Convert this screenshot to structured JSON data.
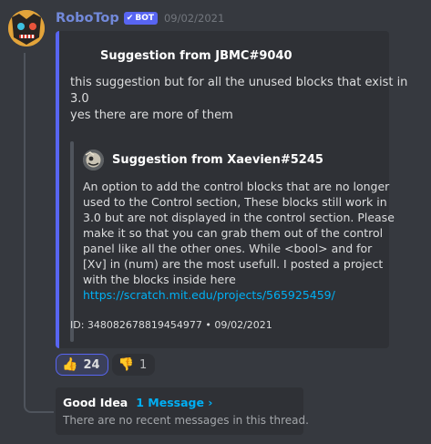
{
  "message": {
    "author": "RoboTop",
    "badge": "BOT",
    "badge_icon": "✔",
    "timestamp": "09/02/2021"
  },
  "embed": {
    "accent_color": "#5865f2",
    "author": "Suggestion from JBMC#9040",
    "description_lines": [
      "this suggestion but for all the unused blocks that exist in",
      "3.0",
      "yes there are more of them"
    ],
    "quote": {
      "author": "Suggestion from Xaevien#5245",
      "body_lines": [
        "An option to add the control blocks that are no longer",
        "used to the Control section, These blocks still work in",
        "3.0 but are not displayed in the control section. Please",
        "make it so that you can grab them out of the control",
        "panel like all the other ones. While <bool> and for",
        "[Xv] in (num) are the most usefull. I posted a project",
        "with the blocks inside here"
      ],
      "link": "https://scratch.mit.edu/projects/565925459/"
    },
    "footer": "ID: 348082678819454977 • 09/02/2021"
  },
  "reactions": [
    {
      "emoji": "👍",
      "emoji_name": "thumbs-up-icon",
      "count": "24",
      "active": true
    },
    {
      "emoji": "👎",
      "emoji_name": "thumbs-down-icon",
      "count": "1",
      "active": false
    }
  ],
  "thread": {
    "name": "Good Idea",
    "count_label": "1 Message ›",
    "subtitle": "There are no recent messages in this thread."
  }
}
